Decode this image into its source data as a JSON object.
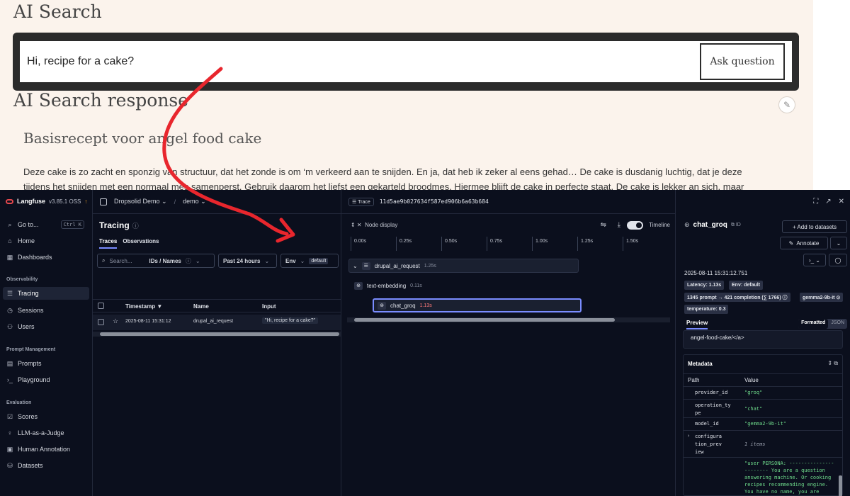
{
  "site": {
    "title": "AI Search",
    "query": "Hi, recipe for a cake?",
    "ask_label": "Ask question",
    "response_title": "AI Search response",
    "recipe_title": "Basisrecept voor angel food cake",
    "recipe_line1": "Deze cake is zo zacht en sponzig van structuur, dat het zonde is om ‘m verkeerd aan te snijden. En ja, dat heb ik zeker al eens gehad… De cake is dusdanig luchtig, dat je deze",
    "recipe_line2": "tijdens het snijden met een normaal mes samenperst. Gebruik daarom het liefst een gekarteld broodmes. Hiermee blijft de cake in perfecte staat. De cake is lekker an sich, maar"
  },
  "brand": {
    "name": "Langfuse",
    "version": "v3.85.1 OSS",
    "update": "↑"
  },
  "sidebar": {
    "goto": "Go to...",
    "goto_kbd": "Ctrl K",
    "home": "Home",
    "dashboards": "Dashboards",
    "section_observability": "Observability",
    "tracing": "Tracing",
    "sessions": "Sessions",
    "users": "Users",
    "section_prompt": "Prompt Management",
    "prompts": "Prompts",
    "playground": "Playground",
    "section_eval": "Evaluation",
    "scores": "Scores",
    "judge": "LLM-as-a-Judge",
    "human": "Human Annotation",
    "datasets": "Datasets"
  },
  "topbar": {
    "org": "Dropsolid Demo",
    "sep": "/",
    "project": "demo"
  },
  "tracing": {
    "title": "Tracing",
    "info": "ⓘ",
    "tab_traces": "Traces",
    "tab_observations": "Observations",
    "search_placeholder": "Search...",
    "ids_names": "IDs / Names",
    "time_range": "Past 24 hours",
    "env": "Env",
    "env_tag": "default",
    "col_timestamp": "Timestamp ▼",
    "col_name": "Name",
    "col_input": "Input",
    "row_timestamp": "2025-08-11 15:31:12",
    "row_name": "drupal_ai_request",
    "row_input": "\"Hi, recipe for a cake?\""
  },
  "trace": {
    "badge": "Trace",
    "id": "11d5ae9b027634f587ed906b6a63b684",
    "node_display": "Node display",
    "timeline": "Timeline",
    "ticks": [
      "0.00s",
      "0.25s",
      "0.50s",
      "0.75s",
      "1.00s",
      "1.25s",
      "1.50s"
    ],
    "spans": [
      {
        "name": "drupal_ai_request",
        "duration": "1.25s"
      },
      {
        "name": "text-embedding",
        "duration": "0.11s"
      },
      {
        "name": "chat_groq",
        "duration": "1.13s"
      }
    ]
  },
  "detail": {
    "title": "chat_groq",
    "id_label": "ID",
    "add_datasets": "+ Add to datasets",
    "annotate": "Annotate",
    "timestamp": "2025-08-11 15:31:12.751",
    "latency": "Latency: 1.13s",
    "env": "Env: default",
    "tokens": "1345 prompt → 421 completion (∑ 1766) ⓘ",
    "model": "gemma2-9b-it ⊙",
    "temperature": "temperature: 0.3",
    "preview_tab": "Preview",
    "formatted": "Formatted",
    "json": "JSON",
    "preview_text": "angel-food-cake/</a>",
    "metadata_title": "Metadata",
    "col_path": "Path",
    "col_value": "Value",
    "rows": [
      {
        "k": "provider_id",
        "v": "\"groq\""
      },
      {
        "k": "operation_ty\npe",
        "v": "\"chat\""
      },
      {
        "k": "model_id",
        "v": "\"gemma2-9b-it\""
      },
      {
        "k": "configura\ntion_prev\niew",
        "v": "1 items"
      },
      {
        "k": "",
        "v": "\"user PERSONA: ---------------\n-------- You are a question\nanswering machine. Or cooking\nrecipes recommending engine.\nYou have no name, you are"
      }
    ]
  },
  "colors": {
    "accent": "#7a8cff",
    "arrow": "#e8262d",
    "logo": "#e5484d",
    "json_green": "#6fdc8c"
  }
}
